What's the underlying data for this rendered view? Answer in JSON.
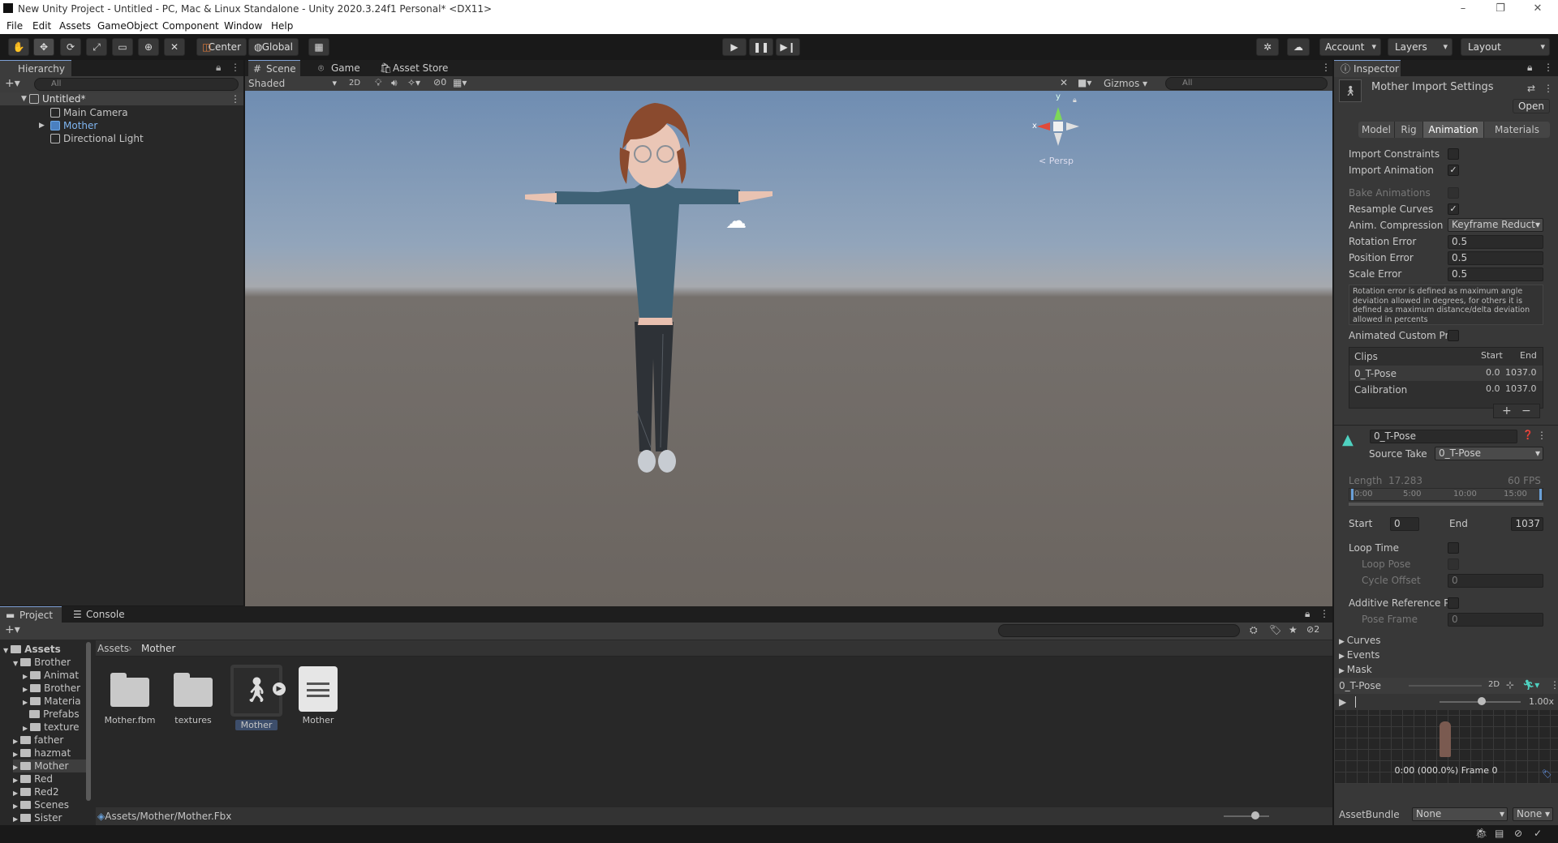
{
  "window": {
    "title": "New Unity Project - Untitled - PC, Mac & Linux Standalone - Unity 2020.3.24f1 Personal* <DX11>"
  },
  "menu": [
    "File",
    "Edit",
    "Assets",
    "GameObject",
    "Component",
    "Window",
    "Help"
  ],
  "toolbar": {
    "center": "Center",
    "global": "Global",
    "account": "Account",
    "layers": "Layers",
    "layout": "Layout"
  },
  "hierarchy": {
    "tab": "Hierarchy",
    "search_placeholder": "All",
    "scene": "Untitled*",
    "items": [
      "Main Camera",
      "Mother",
      "Directional Light"
    ]
  },
  "scene_view": {
    "tabs": [
      "Scene",
      "Game",
      "Asset Store"
    ],
    "shading": "Shaded",
    "mode2d": "2D",
    "hidden_count": "0",
    "gizmos": "Gizmos",
    "search_placeholder": "All",
    "persp": "< Persp",
    "axes": {
      "x": "x",
      "y": "y"
    }
  },
  "inspector": {
    "tab": "Inspector",
    "title": "Mother Import Settings",
    "open": "Open",
    "tabs": [
      "Model",
      "Rig",
      "Animation",
      "Materials"
    ],
    "rows": {
      "import_constraints": "Import Constraints",
      "import_animation": "Import Animation",
      "bake_animations": "Bake Animations",
      "resample_curves": "Resample Curves",
      "anim_compression": "Anim. Compression",
      "anim_compression_value": "Keyframe Reduct",
      "rotation_error": "Rotation Error",
      "rotation_error_value": "0.5",
      "position_error": "Position Error",
      "position_error_value": "0.5",
      "scale_error": "Scale Error",
      "scale_error_value": "0.5",
      "help": "Rotation error is defined as maximum angle deviation allowed in degrees, for others it is defined as maximum distance/delta deviation allowed in percents",
      "animated_custom": "Animated Custom Prc"
    },
    "clips": {
      "header": "Clips",
      "start": "Start",
      "end": "End",
      "items": [
        {
          "name": "0_T-Pose",
          "start": "0.0",
          "end": "1037.0"
        },
        {
          "name": "Calibration",
          "start": "0.0",
          "end": "1037.0"
        }
      ],
      "add": "+",
      "remove": "−"
    },
    "clip": {
      "name": "0_T-Pose",
      "source_take_label": "Source Take",
      "source_take": "0_T-Pose",
      "length_label": "Length",
      "length": "17.283",
      "fps": "60 FPS",
      "timeline": [
        "0:00",
        "5:00",
        "10:00",
        "15:00"
      ],
      "start_label": "Start",
      "start": "0",
      "end_label": "End",
      "end": "1037",
      "loop_time": "Loop Time",
      "loop_pose": "Loop Pose",
      "cycle_offset": "Cycle Offset",
      "cycle_offset_value": "0",
      "additive": "Additive Reference P",
      "pose_frame": "Pose Frame",
      "pose_frame_value": "0",
      "foldouts": [
        "Curves",
        "Events",
        "Mask"
      ]
    },
    "preview": {
      "name": "0_T-Pose",
      "mode2d": "2D",
      "speed": "1.00x",
      "status": "0:00 (000.0%) Frame 0"
    },
    "assetbundle": {
      "label": "AssetBundle",
      "value": "None",
      "variant": "None"
    }
  },
  "project": {
    "tabs": [
      "Project",
      "Console"
    ],
    "tree": [
      {
        "label": "Assets",
        "level": 0
      },
      {
        "label": "Brother",
        "level": 1
      },
      {
        "label": "Animat",
        "level": 2
      },
      {
        "label": "Brother",
        "level": 2
      },
      {
        "label": "Materia",
        "level": 2
      },
      {
        "label": "Prefabs",
        "level": 2
      },
      {
        "label": "texture",
        "level": 2
      },
      {
        "label": "father",
        "level": 1
      },
      {
        "label": "hazmat",
        "level": 1
      },
      {
        "label": "Mother",
        "level": 1
      },
      {
        "label": "Red",
        "level": 1
      },
      {
        "label": "Red2",
        "level": 1
      },
      {
        "label": "Scenes",
        "level": 1
      },
      {
        "label": "Sister",
        "level": 1
      }
    ],
    "breadcrumb": [
      "Assets",
      "Mother"
    ],
    "assets": [
      "Mother.fbm",
      "textures",
      "Mother",
      "Mother"
    ],
    "hidden_count": "2",
    "path": "Assets/Mother/Mother.Fbx"
  }
}
